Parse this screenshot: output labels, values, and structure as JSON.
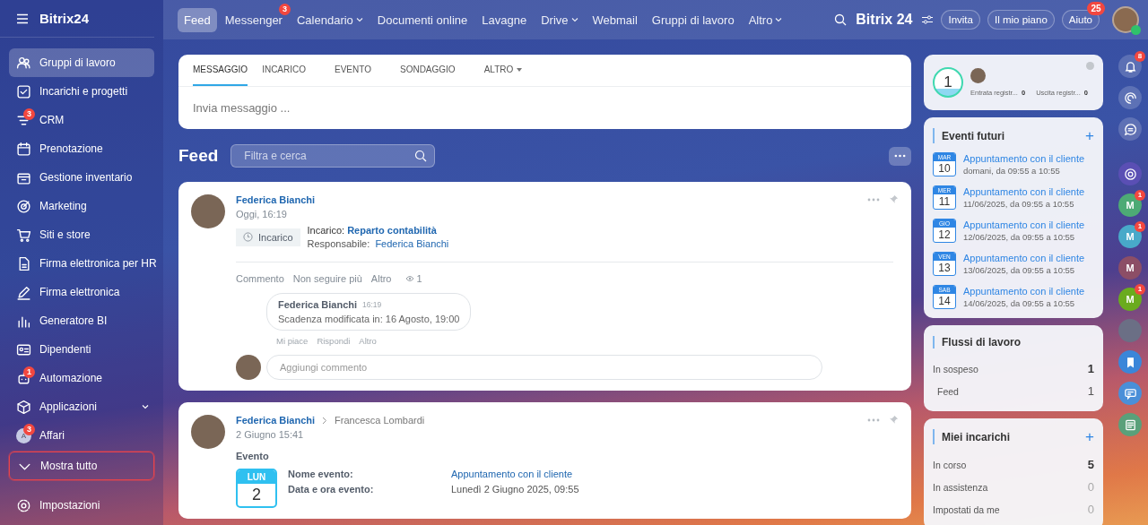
{
  "sidebar": {
    "logo": "Bitrix24",
    "items": [
      {
        "label": "Gruppi di lavoro",
        "selected": true
      },
      {
        "label": "Incarichi e progetti",
        "selected": false
      },
      {
        "label": "CRM",
        "selected": false,
        "badge": "3"
      },
      {
        "label": "Prenotazione",
        "selected": false
      },
      {
        "label": "Gestione inventario",
        "selected": false
      },
      {
        "label": "Marketing",
        "selected": false
      },
      {
        "label": "Siti e store",
        "selected": false
      },
      {
        "label": "Firma elettronica per HR",
        "selected": false
      },
      {
        "label": "Firma elettronica",
        "selected": false
      },
      {
        "label": "Generatore BI",
        "selected": false
      },
      {
        "label": "Dipendenti",
        "selected": false
      },
      {
        "label": "Automazione",
        "selected": false,
        "badge": "1"
      },
      {
        "label": "Applicazioni",
        "selected": false,
        "expandable": true
      },
      {
        "label": "Affari",
        "selected": false,
        "badge": "3",
        "avatar": "A"
      }
    ],
    "show_all": {
      "label": "Mostra tutto",
      "highlighted": true
    },
    "settings": "Impostazioni"
  },
  "topnav": {
    "items": [
      {
        "label": "Feed",
        "selected": true
      },
      {
        "label": "Messenger",
        "selected": false,
        "badge": "3"
      },
      {
        "label": "Calendario",
        "selected": false,
        "dropdown": true
      },
      {
        "label": "Documenti online",
        "selected": false
      },
      {
        "label": "Lavagne",
        "selected": false
      },
      {
        "label": "Drive",
        "selected": false,
        "dropdown": true
      },
      {
        "label": "Webmail",
        "selected": false
      },
      {
        "label": "Gruppi di lavoro",
        "selected": false
      },
      {
        "label": "Altro",
        "selected": false,
        "dropdown": true
      }
    ],
    "brand": "Bitrix",
    "brand_number": "24",
    "buttons": [
      {
        "label": "Invita"
      },
      {
        "label": "Il mio piano"
      },
      {
        "label": "Aiuto",
        "badge": "25"
      }
    ]
  },
  "composer": {
    "tabs": [
      {
        "label": "MESSAGGIO",
        "selected": true
      },
      {
        "label": "INCARICO",
        "selected": false
      },
      {
        "label": "EVENTO",
        "selected": false
      },
      {
        "label": "SONDAGGIO",
        "selected": false
      },
      {
        "label": "ALTRO",
        "selected": false,
        "dropdown": true
      }
    ],
    "placeholder": "Invia messaggio ..."
  },
  "feed": {
    "title": "Feed",
    "search_placeholder": "Filtra e cerca",
    "task_post": {
      "author": "Federica Bianchi",
      "time": "Oggi, 16:19",
      "tag": "Incarico",
      "task_label": "Incarico:",
      "task_link": "Reparto contabilità",
      "responsible_label": "Responsabile:",
      "responsible_link": "Federica Bianchi",
      "actions": [
        "Commento",
        "Non seguire più",
        "Altro"
      ],
      "views": "1",
      "comment": {
        "author": "Federica Bianchi",
        "time": "16:19",
        "text": "Scadenza modificata in: 16 Agosto, 19:00",
        "actions": [
          "Mi piace",
          "Rispondi",
          "Altro"
        ]
      },
      "comment_placeholder": "Aggiungi commento"
    },
    "event_post": {
      "author": "Federica Bianchi",
      "recipient": "Francesca Lombardi",
      "time": "2 Giugno 15:41",
      "type": "Evento",
      "weekday": "LUN",
      "day": "2",
      "fields": [
        {
          "label": "Nome evento:",
          "value": "Appuntamento con il cliente",
          "kind": "link"
        },
        {
          "label": "Data e ora evento:",
          "value": "Lunedì 2 Giugno 2025, 09:55",
          "kind": "text"
        }
      ]
    }
  },
  "worktime": {
    "counter": "1",
    "entries": [
      {
        "label": "Entrata registr...",
        "value": "0"
      },
      {
        "label": "Uscita registr...",
        "value": "0"
      }
    ]
  },
  "events": {
    "title": "Eventi futuri",
    "add_label": "+",
    "items": [
      {
        "weekday": "MAR",
        "day": "10",
        "title": "Appuntamento con il cliente",
        "when": "domani, da 09:55 a 10:55"
      },
      {
        "weekday": "MER",
        "day": "11",
        "title": "Appuntamento con il cliente",
        "when": "11/06/2025, da 09:55 a 10:55"
      },
      {
        "weekday": "GIO",
        "day": "12",
        "title": "Appuntamento con il cliente",
        "when": "12/06/2025, da 09:55 a 10:55"
      },
      {
        "weekday": "VEN",
        "day": "13",
        "title": "Appuntamento con il cliente",
        "when": "13/06/2025, da 09:55 a 10:55"
      },
      {
        "weekday": "SAB",
        "day": "14",
        "title": "Appuntamento con il cliente",
        "when": "14/06/2025, da 09:55 a 10:55"
      }
    ]
  },
  "workflows": {
    "title": "Flussi di lavoro",
    "rows": [
      {
        "label": "In sospeso",
        "value": "1",
        "children": [
          {
            "label": "Feed",
            "value": "1"
          }
        ]
      }
    ]
  },
  "tasks": {
    "title": "Miei incarichi",
    "add_label": "+",
    "rows": [
      {
        "label": "In corso",
        "value": "5",
        "active": true
      },
      {
        "label": "In assistenza",
        "value": "0",
        "active": false
      },
      {
        "label": "Impostati da me",
        "value": "0",
        "active": false
      }
    ]
  },
  "rail": [
    {
      "kind": "bell",
      "badge": "8"
    },
    {
      "kind": "spiral"
    },
    {
      "kind": "chat"
    },
    {
      "kind": "ring"
    },
    {
      "kind": "letter",
      "label": "M",
      "color": "#4daa75",
      "badge": "1"
    },
    {
      "kind": "letter",
      "label": "M",
      "color": "#48a9c9",
      "badge": "1"
    },
    {
      "kind": "letter",
      "label": "M",
      "color": "#8c4e66"
    },
    {
      "kind": "letter",
      "label": "M",
      "color": "#6aab1e",
      "badge": "1"
    },
    {
      "kind": "photo"
    },
    {
      "kind": "bookmark"
    },
    {
      "kind": "message"
    },
    {
      "kind": "news"
    }
  ]
}
